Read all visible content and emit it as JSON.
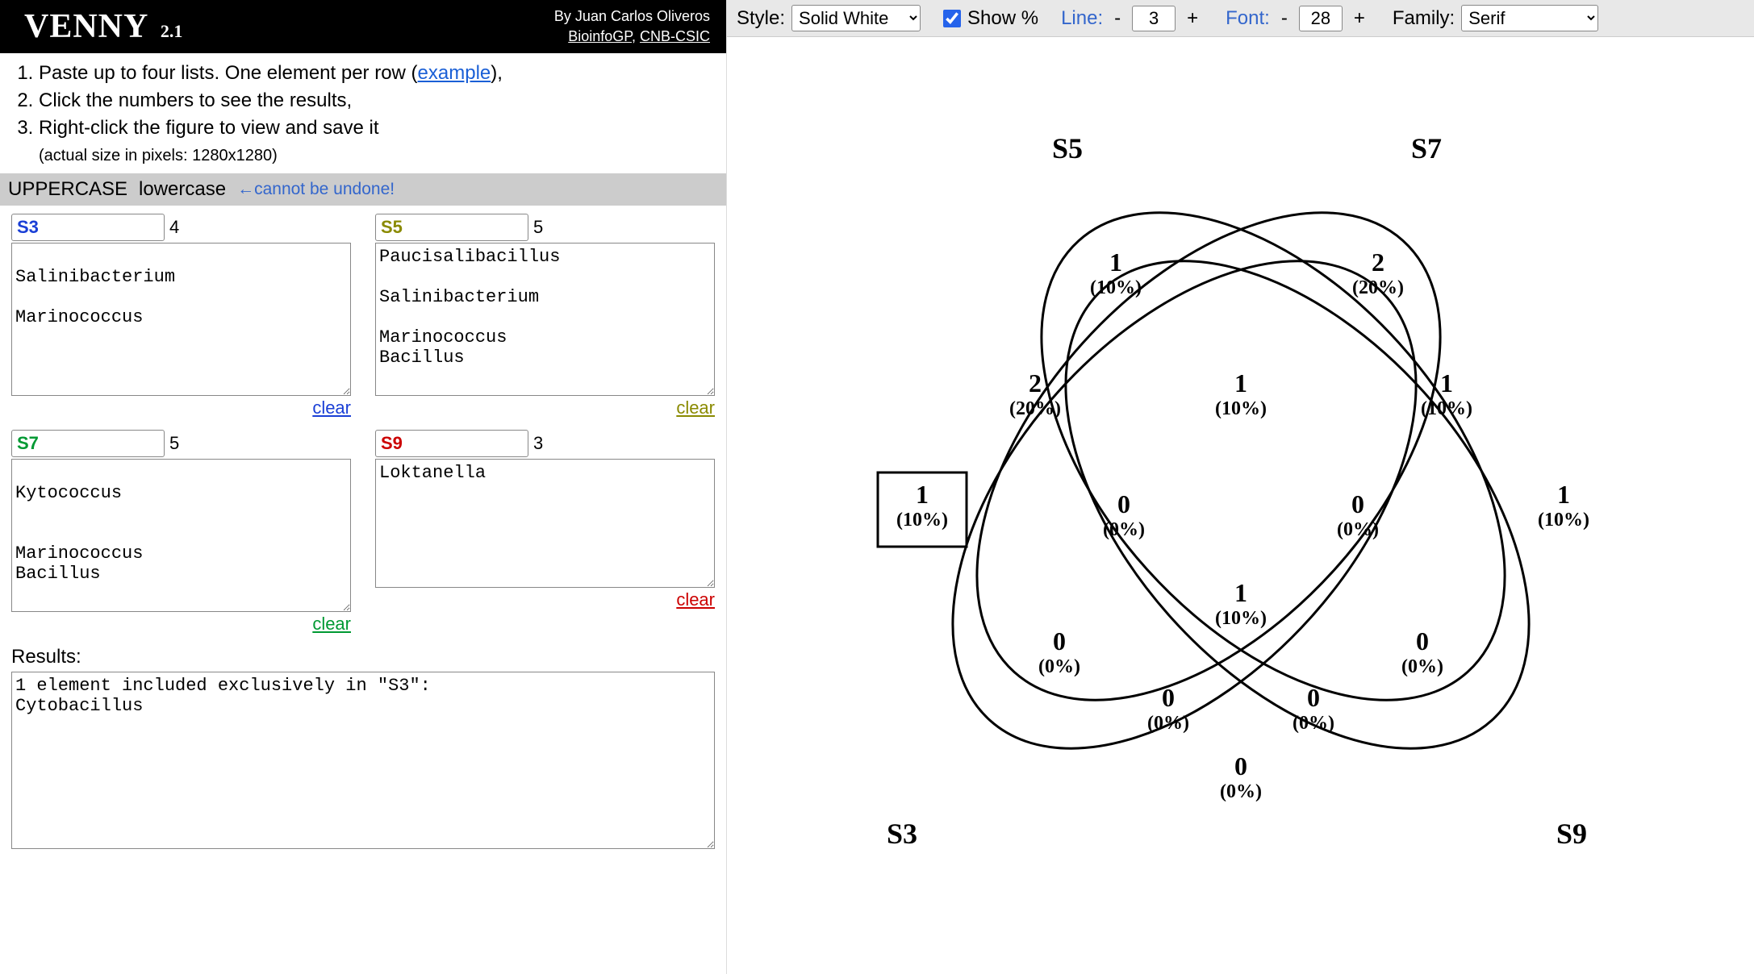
{
  "header": {
    "logo_main": "VENNY",
    "logo_version": "2.1",
    "byline": "By Juan Carlos Oliveros",
    "link1": "BioinfoGP",
    "link2": "CNB-CSIC"
  },
  "instructions": {
    "step1_a": "Paste up to four lists. One element per row (",
    "step1_link": "example",
    "step1_b": "),",
    "step2": "Click the numbers to see the results,",
    "step3": "Right-click the figure to view and save it",
    "pixel_note": "(actual size in pixels: 1280x1280)"
  },
  "case_bar": {
    "upper": "UPPERCASE",
    "lower": "lowercase",
    "undo": "←cannot be undone!"
  },
  "lists": [
    {
      "key": "s3",
      "name": "S3",
      "color": "#1a3fd6",
      "count": "4",
      "text": "\nSalinibacterium\n\nMarinococcus",
      "clear": "clear"
    },
    {
      "key": "s5",
      "name": "S5",
      "color": "#8a8a00",
      "count": "5",
      "text": "Paucisalibacillus\n\nSalinibacterium\n\nMarinococcus\nBacillus",
      "clear": "clear"
    },
    {
      "key": "s7",
      "name": "S7",
      "color": "#009933",
      "count": "5",
      "text": "\nKytococcus\n\n\nMarinococcus\nBacillus",
      "clear": "clear"
    },
    {
      "key": "s9",
      "name": "S9",
      "color": "#cc0000",
      "count": "3",
      "text": "Loktanella",
      "clear": "clear"
    }
  ],
  "results": {
    "label": "Results:",
    "text": "1 element included exclusively in \"S3\":\nCytobacillus"
  },
  "toolbar": {
    "style_label": "Style:",
    "style_value": "Solid White",
    "showpct_label": "Show %",
    "line_label": "Line:",
    "line_value": "3",
    "font_label": "Font:",
    "font_value": "28",
    "family_label": "Family:",
    "family_value": "Serif",
    "minus": "-",
    "plus": "+"
  },
  "chart_data": {
    "type": "venn4",
    "sets": [
      {
        "id": "S3",
        "label": "S3"
      },
      {
        "id": "S5",
        "label": "S5"
      },
      {
        "id": "S7",
        "label": "S7"
      },
      {
        "id": "S9",
        "label": "S9"
      }
    ],
    "regions": {
      "S5_only": {
        "count": "1",
        "pct": "(10%)"
      },
      "S7_only": {
        "count": "2",
        "pct": "(20%)"
      },
      "S3_S5": {
        "count": "2",
        "pct": "(20%)"
      },
      "S5_S7": {
        "count": "1",
        "pct": "(10%)"
      },
      "S7_S9": {
        "count": "1",
        "pct": "(10%)"
      },
      "S3_only": {
        "count": "1",
        "pct": "(10%)",
        "selected": true
      },
      "S3_S5_S7": {
        "count": "0",
        "pct": "(0%)"
      },
      "S5_S7_S9": {
        "count": "0",
        "pct": "(0%)"
      },
      "S9_only": {
        "count": "1",
        "pct": "(10%)"
      },
      "S3_S5_S7_S9": {
        "count": "1",
        "pct": "(10%)"
      },
      "S3_S5_S9": {
        "count": "0",
        "pct": "(0%)"
      },
      "S3_S7_S9": {
        "count": "0",
        "pct": "(0%)"
      },
      "S3_S7": {
        "count": "0",
        "pct": "(0%)"
      },
      "S5_S9": {
        "count": "0",
        "pct": "(0%)"
      },
      "S3_S9": {
        "count": "0",
        "pct": "(0%)"
      }
    }
  }
}
